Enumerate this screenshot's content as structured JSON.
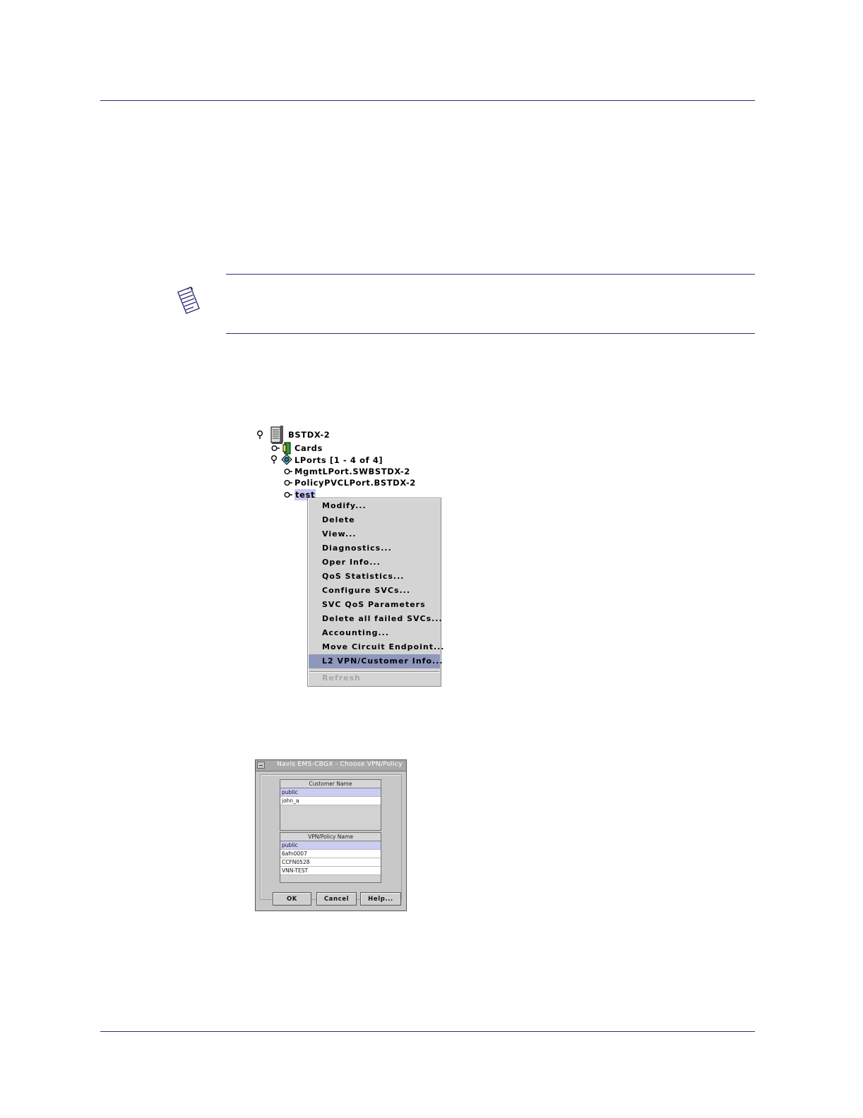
{
  "tree": {
    "root": {
      "label": "BSTDX-2",
      "icon": "switch-icon"
    },
    "cards": {
      "label": "Cards",
      "icon": "cards-icon"
    },
    "lports": {
      "label": "LPorts [1 - 4 of 4]",
      "icon": "lports-icon"
    },
    "items": [
      {
        "label": "MgmtLPort.SWBSTDX-2"
      },
      {
        "label": "PolicyPVCLPort.BSTDX-2"
      },
      {
        "label": "test",
        "selected": true
      }
    ]
  },
  "context_menu": {
    "items": [
      {
        "label": "Modify..."
      },
      {
        "label": "Delete"
      },
      {
        "label": "View..."
      },
      {
        "label": "Diagnostics..."
      },
      {
        "label": "Oper Info..."
      },
      {
        "label": "QoS Statistics..."
      },
      {
        "label": "Configure SVCs..."
      },
      {
        "label": "SVC QoS Parameters"
      },
      {
        "label": "Delete all failed SVCs..."
      },
      {
        "label": "Accounting..."
      },
      {
        "label": "Move Circuit Endpoint..."
      },
      {
        "label": "L2 VPN/Customer Info...",
        "highlighted": true
      }
    ],
    "refresh_label": "Refresh",
    "highlight_color": "#8f97bd"
  },
  "dialog": {
    "title": "Navis EMS-CBGX - Choose VPN/Policy",
    "customer_list": {
      "header": "Customer Name",
      "rows": [
        "public",
        "john_a"
      ]
    },
    "policy_list": {
      "header": "VPN/Policy Name",
      "rows": [
        "public",
        "6afn0007",
        "CCFN0528",
        "VNN-TEST"
      ]
    },
    "buttons": {
      "ok": "OK",
      "cancel": "Cancel",
      "help": "Help..."
    }
  },
  "colors": {
    "rule": "#2b2f74",
    "selection": "#ccccf2"
  }
}
